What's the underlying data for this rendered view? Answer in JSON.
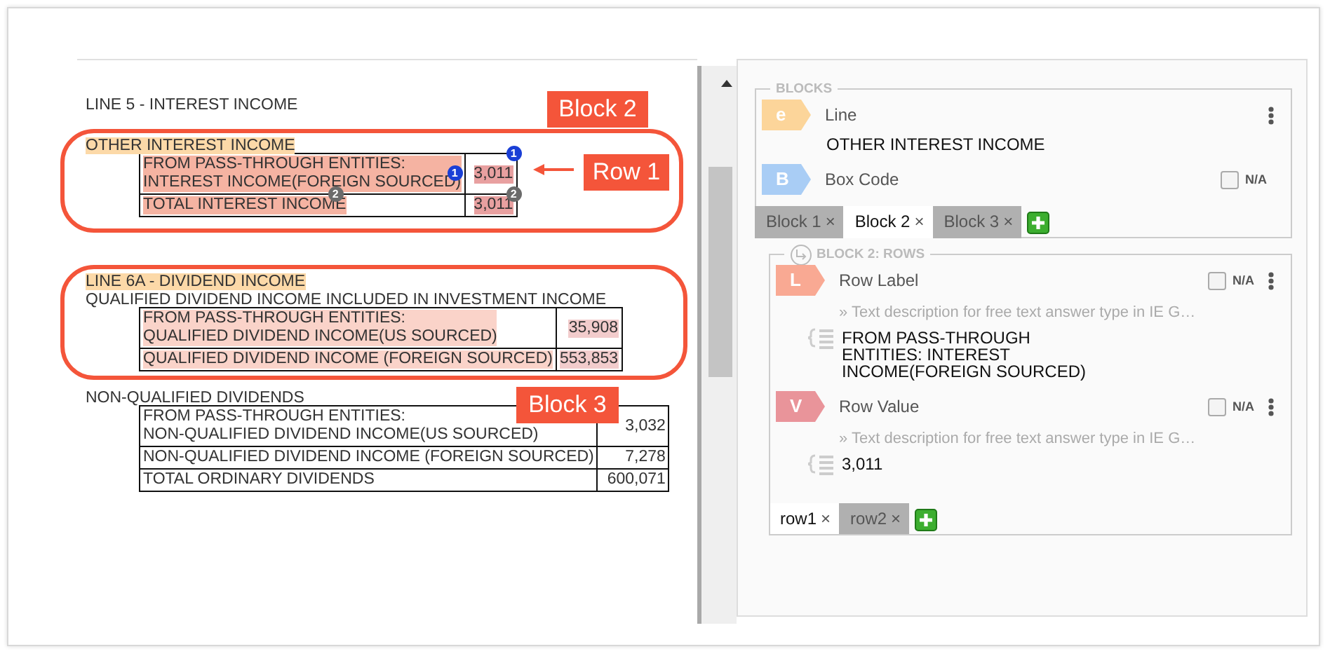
{
  "document": {
    "items": [
      {
        "kind": "text",
        "text": "LINE 5 - INTEREST INCOME",
        "highlighted": false
      },
      {
        "kind": "text",
        "text": "OTHER INTEREST INCOME",
        "highlighted": true
      },
      {
        "kind": "table",
        "rows": [
          {
            "label": {
              "text": "FROM PASS-THROUGH ENTITIES:\nINTEREST INCOME(FOREIGN SOURCED)",
              "color": "#f5b3a2"
            },
            "value": {
              "text": "3,011",
              "color": "#e8a0a0"
            },
            "label_badge": {
              "text": "1",
              "color": "#1a3fd6"
            },
            "value_badge": {
              "text": "1",
              "color": "#1a3fd6"
            }
          },
          {
            "label": {
              "text": "TOTAL INTEREST INCOME",
              "color": "#f5b3a2"
            },
            "value": {
              "text": "3,011",
              "color": "#e8a0a0"
            },
            "label_badge": {
              "text": "2",
              "color": "#6b6b6b"
            },
            "value_badge": {
              "text": "2",
              "color": "#6b6b6b"
            }
          }
        ]
      },
      {
        "kind": "text",
        "text": "LINE 6A - DIVIDEND INCOME",
        "highlighted": true
      },
      {
        "kind": "text",
        "text": "QUALIFIED DIVIDEND INCOME INCLUDED IN INVESTMENT INCOME",
        "highlighted": false
      },
      {
        "kind": "table",
        "rows": [
          {
            "label": {
              "text": "FROM PASS-THROUGH ENTITIES:\nQUALIFIED DIVIDEND INCOME(US SOURCED)",
              "color": "#fad3c9"
            },
            "value": {
              "text": "35,908",
              "color": "#f2cccc"
            }
          },
          {
            "label": {
              "text": "QUALIFIED DIVIDEND INCOME (FOREIGN SOURCED)",
              "color": "#fad3c9"
            },
            "value": {
              "text": "553,853",
              "color": "#f2cccc"
            }
          }
        ]
      },
      {
        "kind": "text",
        "text": "NON-QUALIFIED DIVIDENDS",
        "highlighted": false
      },
      {
        "kind": "table",
        "rows": [
          {
            "label": {
              "text": "FROM PASS-THROUGH ENTITIES:\nNON-QUALIFIED DIVIDEND INCOME(US SOURCED)"
            },
            "value": {
              "text": "3,032"
            }
          },
          {
            "label": {
              "text": "NON-QUALIFIED DIVIDEND INCOME (FOREIGN SOURCED)"
            },
            "value": {
              "text": "7,278"
            }
          },
          {
            "label": {
              "text": "TOTAL ORDINARY DIVIDENDS"
            },
            "value": {
              "text": "600,071"
            }
          }
        ]
      }
    ]
  },
  "annotations": [
    {
      "kind": "frame"
    },
    {
      "kind": "frame"
    },
    {
      "kind": "callout",
      "text": "Block 2"
    },
    {
      "kind": "callout",
      "text": "Row 1"
    },
    {
      "kind": "arrow"
    },
    {
      "kind": "callout",
      "text": "Block 3"
    }
  ],
  "panel": {
    "blocks": {
      "legend": "BLOCKS",
      "fields": [
        {
          "kind": "plain",
          "tag": "e",
          "color": "#fcd59a",
          "title": "Line",
          "menu": true,
          "value": "OTHER INTEREST INCOME"
        },
        {
          "kind": "plain",
          "tag": "B",
          "color": "#a9cdf5",
          "title": "Box Code",
          "menu": false,
          "na": {
            "label": "N/A",
            "checked": false
          }
        }
      ],
      "tabs": [
        {
          "label": "Block 1",
          "close": "×",
          "selected": false
        },
        {
          "label": "Block 2",
          "close": "×",
          "selected": true
        },
        {
          "label": "Block 3",
          "close": "×",
          "selected": false
        }
      ]
    },
    "rows": {
      "legend": "BLOCK 2: ROWS",
      "fields": [
        {
          "kind": "mapped",
          "tag": "L",
          "color": "#f9a993",
          "title": "Row Label",
          "menu": true,
          "na": {
            "label": "N/A",
            "checked": false
          },
          "description": "» Text description for free text answer type in IE G…",
          "value": "FROM PASS-THROUGH ENTITIES: INTEREST INCOME(FOREIGN SOURCED)"
        },
        {
          "kind": "mapped",
          "tag": "V",
          "color": "#e9949a",
          "title": "Row Value",
          "menu": true,
          "na": {
            "label": "N/A",
            "checked": false
          },
          "description": "» Text description for free text answer type in IE G…",
          "value": "3,011"
        }
      ],
      "tabs": [
        {
          "label": "row1",
          "close": "×",
          "selected": true
        },
        {
          "label": "row2",
          "close": "×",
          "selected": false
        }
      ]
    }
  }
}
